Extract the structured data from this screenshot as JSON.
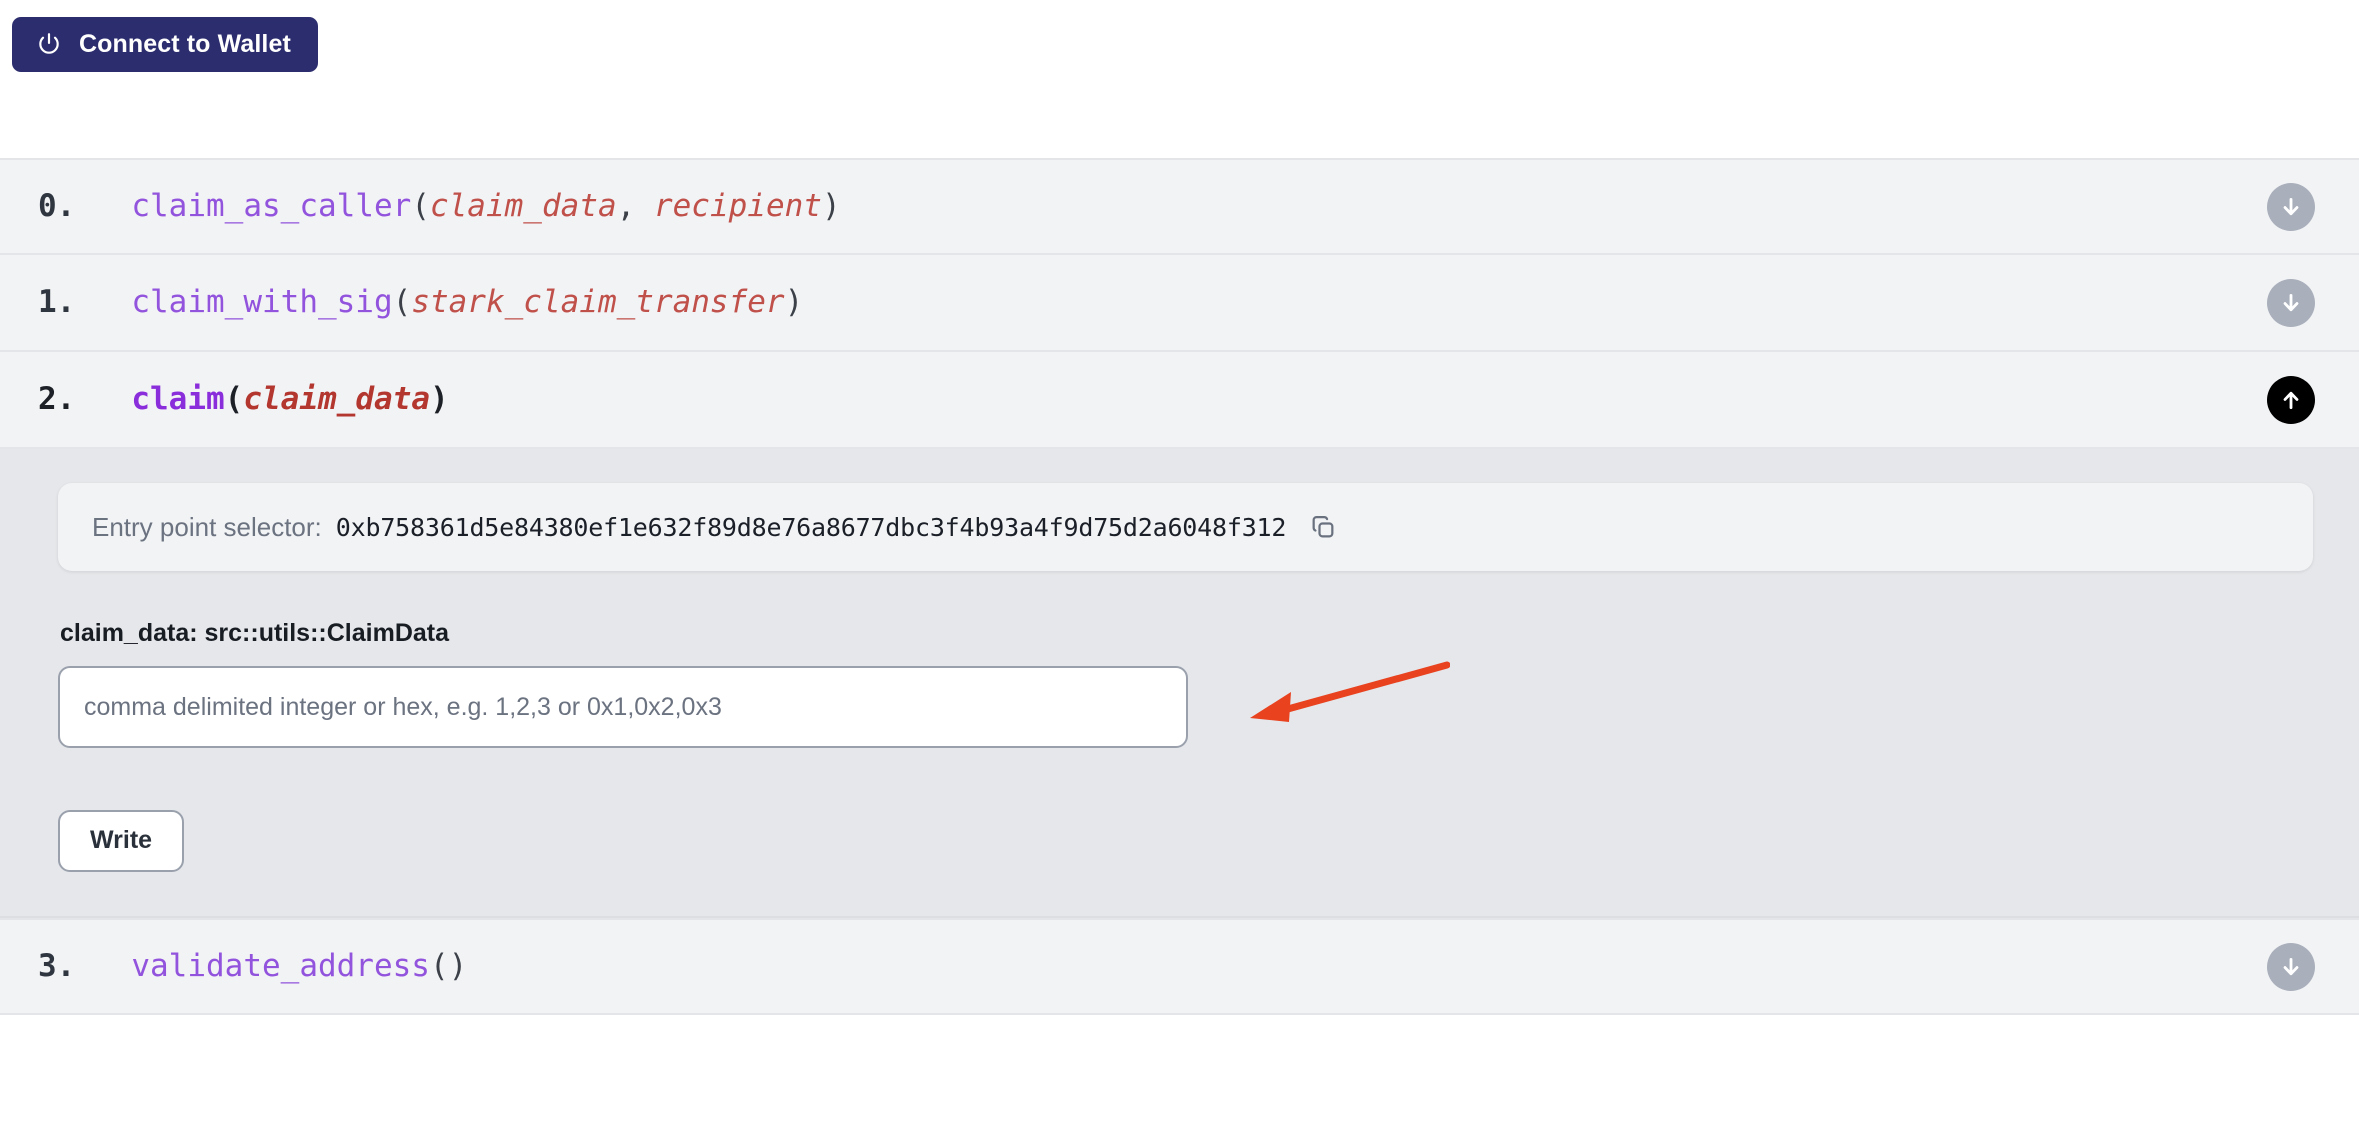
{
  "wallet": {
    "connect_label": "Connect to Wallet",
    "icon": "power-icon",
    "background_color": "#2c2d6e"
  },
  "functions": [
    {
      "index": "0.",
      "name": "claim_as_caller",
      "params": [
        "claim_data",
        "recipient"
      ],
      "expanded": false,
      "toggle_icon": "arrow-down-circle-icon"
    },
    {
      "index": "1.",
      "name": "claim_with_sig",
      "params": [
        "stark_claim_transfer"
      ],
      "expanded": false,
      "toggle_icon": "arrow-down-circle-icon"
    },
    {
      "index": "2.",
      "name": "claim",
      "params": [
        "claim_data"
      ],
      "expanded": true,
      "toggle_icon": "arrow-up-circle-icon"
    },
    {
      "index": "3.",
      "name": "validate_address",
      "params": [],
      "expanded": false,
      "toggle_icon": "arrow-down-circle-icon"
    }
  ],
  "panel": {
    "selector_label": "Entry point selector:",
    "selector_value": "0xb758361d5e84380ef1e632f89d8e76a8677dbc3f4b93a4f9d75d2a6048f312",
    "copy_icon": "copy-icon",
    "field_label": "claim_data: src::utils::ClaimData",
    "input_value": "",
    "input_placeholder": "comma delimited integer or hex, e.g. 1,2,3 or 0x1,0x2,0x3",
    "write_label": "Write"
  },
  "annotation": {
    "type": "arrow",
    "color": "#e8421f",
    "points_to": "claim_data-input"
  },
  "colors": {
    "row_background": "#f2f3f5",
    "panel_background": "#e5e7ea",
    "function_name": "#9253dd",
    "parameter": "#c0504a",
    "toggle_inactive": "#a9afbb",
    "toggle_active": "#000000"
  }
}
